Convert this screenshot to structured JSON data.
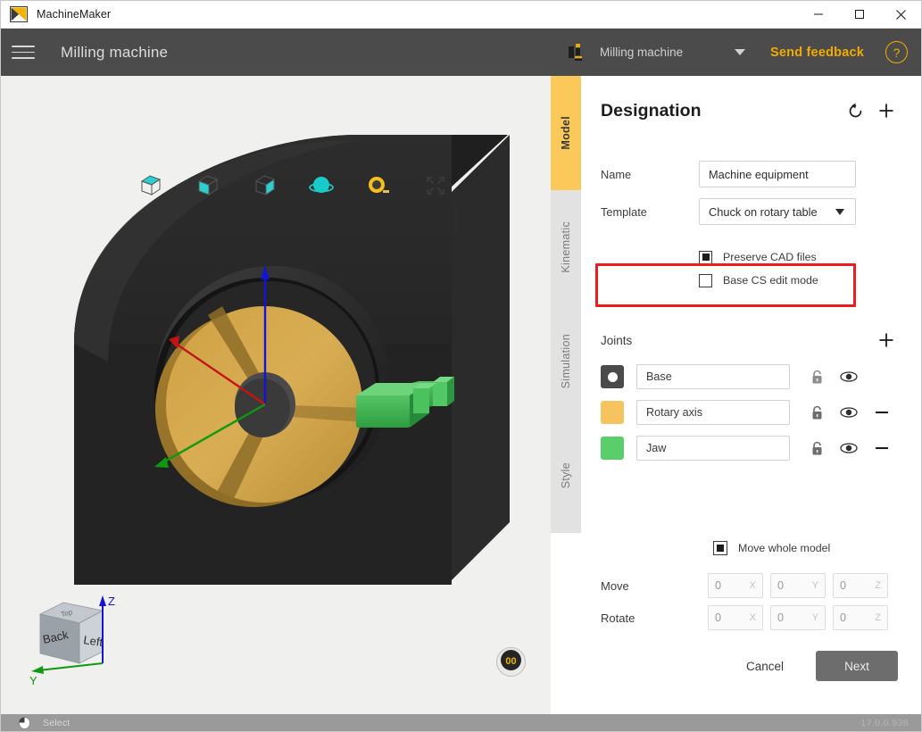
{
  "window": {
    "app_title": "MachineMaker",
    "logo_icon": "machinemaker-logo-icon",
    "minimize_icon": "minimize-icon",
    "maximize_icon": "maximize-icon",
    "close_icon": "close-icon"
  },
  "header": {
    "menu_icon": "hamburger-menu-icon",
    "title": "Milling machine",
    "machine_selector": {
      "icon": "machine-icon",
      "value": "Milling machine",
      "caret_icon": "chevron-down-icon"
    },
    "feedback_label": "Send feedback",
    "help_label": "?",
    "accent_color": "#f2ab00",
    "background_color": "#4b4b4b"
  },
  "viewport": {
    "toolbar": [
      {
        "name": "view-top-face-icon",
        "label": "Top face"
      },
      {
        "name": "view-front-face-icon",
        "label": "Front face"
      },
      {
        "name": "view-side-face-icon",
        "label": "Side face"
      },
      {
        "name": "orbit-rotate-icon",
        "label": "Rotate"
      },
      {
        "name": "measure-tape-icon",
        "label": "Measure"
      },
      {
        "name": "fit-to-screen-icon",
        "label": "Fit to screen"
      }
    ],
    "axis_cube": {
      "face_left": "Left",
      "face_back": "Back",
      "face_top": "Top",
      "axis_z": "Z",
      "axis_y": "Y",
      "axis_z_color": "#1414d2",
      "axis_y_color": "#119911"
    },
    "badge_label": "00",
    "background_color": "#f0f0ee",
    "model_colors": {
      "body": "#262626",
      "chuck": "#d2a63f",
      "jaw": "#35b14a",
      "axis_x": "#c41414",
      "axis_y": "#0e9a0e",
      "axis_z": "#1414d2"
    }
  },
  "tabs": [
    {
      "label": "Model",
      "active": true
    },
    {
      "label": "Kinematic",
      "active": false
    },
    {
      "label": "Simulation",
      "active": false
    },
    {
      "label": "Style",
      "active": false
    }
  ],
  "panel": {
    "title": "Designation",
    "reset_icon": "reset-rotate-icon",
    "add_icon": "plus-icon",
    "fields": [
      {
        "label": "Name",
        "value": "Machine equipment",
        "type": "text"
      },
      {
        "label": "Template",
        "value": "Chuck on rotary table",
        "type": "select",
        "highlighted": true
      }
    ],
    "checkboxes": [
      {
        "label": "Preserve CAD files",
        "checked": true
      },
      {
        "label": "Base CS edit mode",
        "checked": false
      }
    ],
    "joints": {
      "title": "Joints",
      "add_icon": "plus-icon",
      "rows": [
        {
          "color": "#4a4a4a",
          "name": "Base",
          "has_dot": true,
          "lock_icon": "unlock-icon",
          "eye_icon": "eye-icon",
          "remove_icon": null
        },
        {
          "color": "#f5c45e",
          "name": "Rotary axis",
          "has_dot": false,
          "lock_icon": "unlock-icon",
          "eye_icon": "eye-icon",
          "remove_icon": "minus-icon"
        },
        {
          "color": "#5ace6a",
          "name": "Jaw",
          "has_dot": false,
          "lock_icon": "unlock-icon",
          "eye_icon": "eye-icon",
          "remove_icon": "minus-icon"
        }
      ]
    },
    "move_whole_model": {
      "label": "Move whole model",
      "checked": true
    },
    "transform": [
      {
        "label": "Move",
        "x": "0",
        "y": "0",
        "z": "0",
        "ax_x": "X",
        "ax_y": "Y",
        "ax_z": "Z"
      },
      {
        "label": "Rotate",
        "x": "0",
        "y": "0",
        "z": "0",
        "ax_x": "X",
        "ax_y": "Y",
        "ax_z": "Z"
      }
    ],
    "cancel_label": "Cancel",
    "next_label": "Next",
    "highlight_color": "#ee1c1c"
  },
  "statusbar": {
    "mouse_icon": "mouse-icon",
    "mode": "Select",
    "version": "17.0.0.938"
  }
}
